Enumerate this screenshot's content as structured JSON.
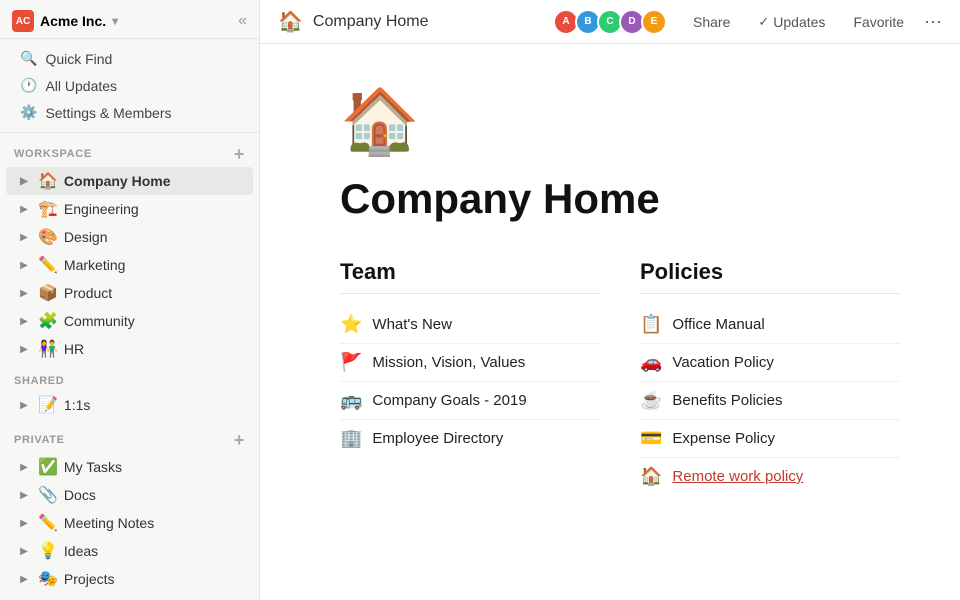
{
  "sidebar": {
    "workspace": {
      "name": "Acme Inc.",
      "avatar_text": "AC",
      "collapse_label": "«"
    },
    "nav_items": [
      {
        "id": "quick-find",
        "label": "Quick Find",
        "icon": "🔍"
      },
      {
        "id": "all-updates",
        "label": "All Updates",
        "icon": "🕐"
      },
      {
        "id": "settings",
        "label": "Settings & Members",
        "icon": "⚙️"
      }
    ],
    "workspace_section": "WORKSPACE",
    "workspace_items": [
      {
        "id": "company-home",
        "label": "Company Home",
        "icon": "🏠",
        "active": true
      },
      {
        "id": "engineering",
        "label": "Engineering",
        "icon": "🏗️"
      },
      {
        "id": "design",
        "label": "Design",
        "icon": "🎨"
      },
      {
        "id": "marketing",
        "label": "Marketing",
        "icon": "✏️"
      },
      {
        "id": "product",
        "label": "Product",
        "icon": "📦"
      },
      {
        "id": "community",
        "label": "Community",
        "icon": "🧩"
      },
      {
        "id": "hr",
        "label": "HR",
        "icon": "👫"
      }
    ],
    "shared_section": "SHARED",
    "shared_items": [
      {
        "id": "1on1s",
        "label": "1:1s",
        "icon": "📝"
      }
    ],
    "private_section": "PRIVATE",
    "private_items": [
      {
        "id": "my-tasks",
        "label": "My Tasks",
        "icon": "✅"
      },
      {
        "id": "docs",
        "label": "Docs",
        "icon": "📎"
      },
      {
        "id": "meeting-notes",
        "label": "Meeting Notes",
        "icon": "✏️"
      },
      {
        "id": "ideas",
        "label": "Ideas",
        "icon": "💡"
      },
      {
        "id": "projects",
        "label": "Projects",
        "icon": "🎭"
      }
    ]
  },
  "topbar": {
    "page_icon": "🏠",
    "page_title": "Company Home",
    "share_label": "Share",
    "updates_label": "Updates",
    "favorite_label": "Favorite",
    "avatars": [
      {
        "color": "#e74c3c",
        "initials": "A"
      },
      {
        "color": "#3498db",
        "initials": "B"
      },
      {
        "color": "#2ecc71",
        "initials": "C"
      },
      {
        "color": "#9b59b6",
        "initials": "D"
      },
      {
        "color": "#f39c12",
        "initials": "E"
      }
    ]
  },
  "page": {
    "emoji": "🏠",
    "title": "Company Home",
    "team_section": "Team",
    "team_items": [
      {
        "icon": "⭐",
        "label": "What's New"
      },
      {
        "icon": "🚩",
        "label": "Mission, Vision, Values"
      },
      {
        "icon": "🚌",
        "label": "Company Goals - 2019"
      },
      {
        "icon": "🏢",
        "label": "Employee Directory"
      }
    ],
    "policies_section": "Policies",
    "policies_items": [
      {
        "icon": "📋",
        "label": "Office Manual"
      },
      {
        "icon": "🚗",
        "label": "Vacation Policy"
      },
      {
        "icon": "☕",
        "label": "Benefits Policies"
      },
      {
        "icon": "💳",
        "label": "Expense Policy"
      },
      {
        "icon": "🏠",
        "label": "Remote work policy",
        "underline": true
      }
    ]
  }
}
